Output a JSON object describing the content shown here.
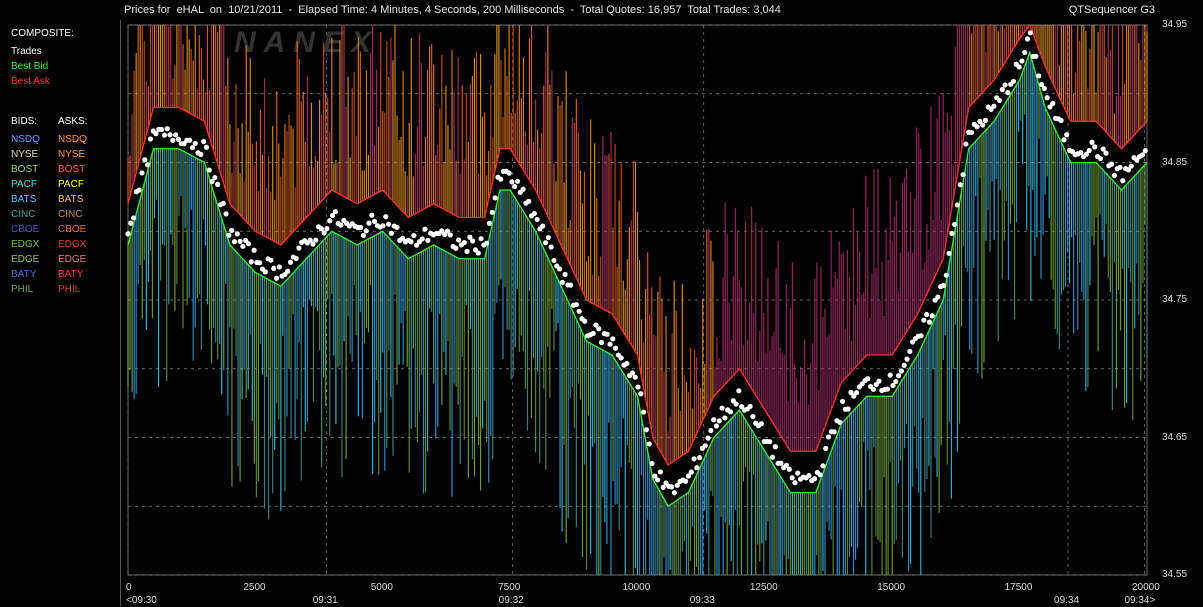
{
  "window": {
    "title": "Prices for  eHAL  on  10/21/2011  -  Elapsed Time: 4 Minutes, 4 Seconds, 200 Milliseconds  -  Total Quotes: 16,957  Total Trades: 3,044",
    "app_name": "QTSequencer G3"
  },
  "legend": {
    "composite_header": "COMPOSITE:",
    "composite": [
      {
        "label": "Trades",
        "color": "#ffffff"
      },
      {
        "label": "Best Bid",
        "color": "#33ee33"
      },
      {
        "label": "Best Ask",
        "color": "#ff3333"
      }
    ],
    "bids_header": "BIDS:",
    "asks_header": "ASKS:",
    "exchanges": [
      {
        "bid": "NSDQ",
        "ask": "NSDQ",
        "bid_color": "#5aa0ff",
        "ask_color": "#ff9a3c"
      },
      {
        "bid": "NYSE",
        "ask": "NYSE",
        "bid_color": "#e0e0a0",
        "ask_color": "#ff9a3c"
      },
      {
        "bid": "BOST",
        "ask": "BOST",
        "bid_color": "#9ad060",
        "ask_color": "#ff6060"
      },
      {
        "bid": "PACF",
        "ask": "PACF",
        "bid_color": "#40e0e0",
        "ask_color": "#ffff40"
      },
      {
        "bid": "BATS",
        "ask": "BATS",
        "bid_color": "#60c0ff",
        "ask_color": "#ffc040"
      },
      {
        "bid": "CINC",
        "ask": "CINC",
        "bid_color": "#40a0a0",
        "ask_color": "#c09050"
      },
      {
        "bid": "CBOE",
        "ask": "CBOE",
        "bid_color": "#3060c0",
        "ask_color": "#e07030"
      },
      {
        "bid": "EDGX",
        "ask": "EDGX",
        "bid_color": "#70c040",
        "ask_color": "#d04040"
      },
      {
        "bid": "EDGE",
        "ask": "EDGE",
        "bid_color": "#90c070",
        "ask_color": "#e08080"
      },
      {
        "bid": "BATY",
        "ask": "BATY",
        "bid_color": "#5070d0",
        "ask_color": "#ff4040"
      },
      {
        "bid": "PHIL",
        "ask": "PHIL",
        "bid_color": "#80a040",
        "ask_color": "#c04040"
      }
    ]
  },
  "watermark": "NANEX",
  "chart_data": {
    "type": "line",
    "title": "Prices for  eHAL  on  10/21/2011",
    "x_range": [
      0,
      20000
    ],
    "ylim": [
      34.55,
      34.95
    ],
    "y_ticks": [
      "34.95",
      "34.85",
      "34.75",
      "34.65",
      "34.55"
    ],
    "x_ticks": [
      "0",
      "2500",
      "5000",
      "7500",
      "10000",
      "12500",
      "15000",
      "17500",
      "20000"
    ],
    "x_tick_values": [
      0,
      2500,
      5000,
      7500,
      10000,
      12500,
      15000,
      17500,
      20000
    ],
    "time_labels": [
      {
        "x": 0,
        "label": "<09:30"
      },
      {
        "x": 3900,
        "label": "09:31"
      },
      {
        "x": 7550,
        "label": "09:32"
      },
      {
        "x": 11300,
        "label": "09:33"
      },
      {
        "x": 18450,
        "label": "09:34"
      },
      {
        "x": 19950,
        "label": "09:34>"
      }
    ],
    "grid": true,
    "series": [
      {
        "name": "Trades",
        "color": "#ffffff",
        "x": [
          0,
          500,
          1000,
          1500,
          2000,
          2500,
          3000,
          3500,
          4000,
          4500,
          5000,
          5500,
          6000,
          6500,
          7000,
          7300,
          7500,
          8000,
          8500,
          9000,
          9500,
          10000,
          10300,
          10600,
          11000,
          11500,
          12000,
          12500,
          13000,
          13500,
          14000,
          14500,
          15000,
          15500,
          16000,
          16500,
          17000,
          17500,
          17700,
          18000,
          18500,
          19000,
          19500,
          20000
        ],
        "y": [
          34.8,
          34.87,
          34.87,
          34.86,
          34.8,
          34.78,
          34.77,
          34.79,
          34.81,
          34.8,
          34.81,
          34.79,
          34.8,
          34.79,
          34.79,
          34.84,
          34.84,
          34.81,
          34.77,
          34.73,
          34.72,
          34.69,
          34.63,
          34.61,
          34.62,
          34.66,
          34.68,
          34.65,
          34.62,
          34.62,
          34.67,
          34.69,
          34.69,
          34.72,
          34.76,
          34.87,
          34.89,
          34.92,
          34.94,
          34.9,
          34.86,
          34.86,
          34.84,
          34.86
        ]
      },
      {
        "name": "Best Bid",
        "color": "#33ee33",
        "x": [
          0,
          500,
          1000,
          1500,
          2000,
          2500,
          3000,
          3500,
          4000,
          4500,
          5000,
          5500,
          6000,
          6500,
          7000,
          7300,
          7500,
          8000,
          8500,
          9000,
          9500,
          10000,
          10300,
          10600,
          11000,
          11500,
          12000,
          12500,
          13000,
          13500,
          14000,
          14500,
          15000,
          15500,
          16000,
          16500,
          17000,
          17500,
          17700,
          18000,
          18500,
          19000,
          19500,
          20000
        ],
        "y": [
          34.79,
          34.86,
          34.86,
          34.85,
          34.79,
          34.77,
          34.76,
          34.78,
          34.8,
          34.79,
          34.8,
          34.78,
          34.79,
          34.78,
          34.78,
          34.83,
          34.83,
          34.8,
          34.76,
          34.72,
          34.71,
          34.68,
          34.62,
          34.6,
          34.61,
          34.65,
          34.67,
          34.64,
          34.61,
          34.61,
          34.66,
          34.68,
          34.68,
          34.71,
          34.75,
          34.86,
          34.88,
          34.91,
          34.93,
          34.89,
          34.85,
          34.85,
          34.83,
          34.85
        ]
      },
      {
        "name": "Best Ask",
        "color": "#ff3333",
        "x": [
          0,
          500,
          1000,
          1500,
          2000,
          2500,
          3000,
          3500,
          4000,
          4500,
          5000,
          5500,
          6000,
          6500,
          7000,
          7300,
          7500,
          8000,
          8500,
          9000,
          9500,
          10000,
          10300,
          10600,
          11000,
          11500,
          12000,
          12500,
          13000,
          13500,
          14000,
          14500,
          15000,
          15500,
          16000,
          16500,
          17000,
          17500,
          17700,
          18000,
          18500,
          19000,
          19500,
          20000
        ],
        "y": [
          34.82,
          34.89,
          34.89,
          34.88,
          34.82,
          34.8,
          34.79,
          34.81,
          34.83,
          34.82,
          34.83,
          34.81,
          34.82,
          34.81,
          34.81,
          34.86,
          34.86,
          34.83,
          34.79,
          34.75,
          34.74,
          34.71,
          34.65,
          34.63,
          34.64,
          34.68,
          34.7,
          34.67,
          34.64,
          34.64,
          34.69,
          34.71,
          34.71,
          34.74,
          34.78,
          34.89,
          34.91,
          34.94,
          34.95,
          34.92,
          34.88,
          34.88,
          34.86,
          34.88
        ]
      }
    ]
  }
}
